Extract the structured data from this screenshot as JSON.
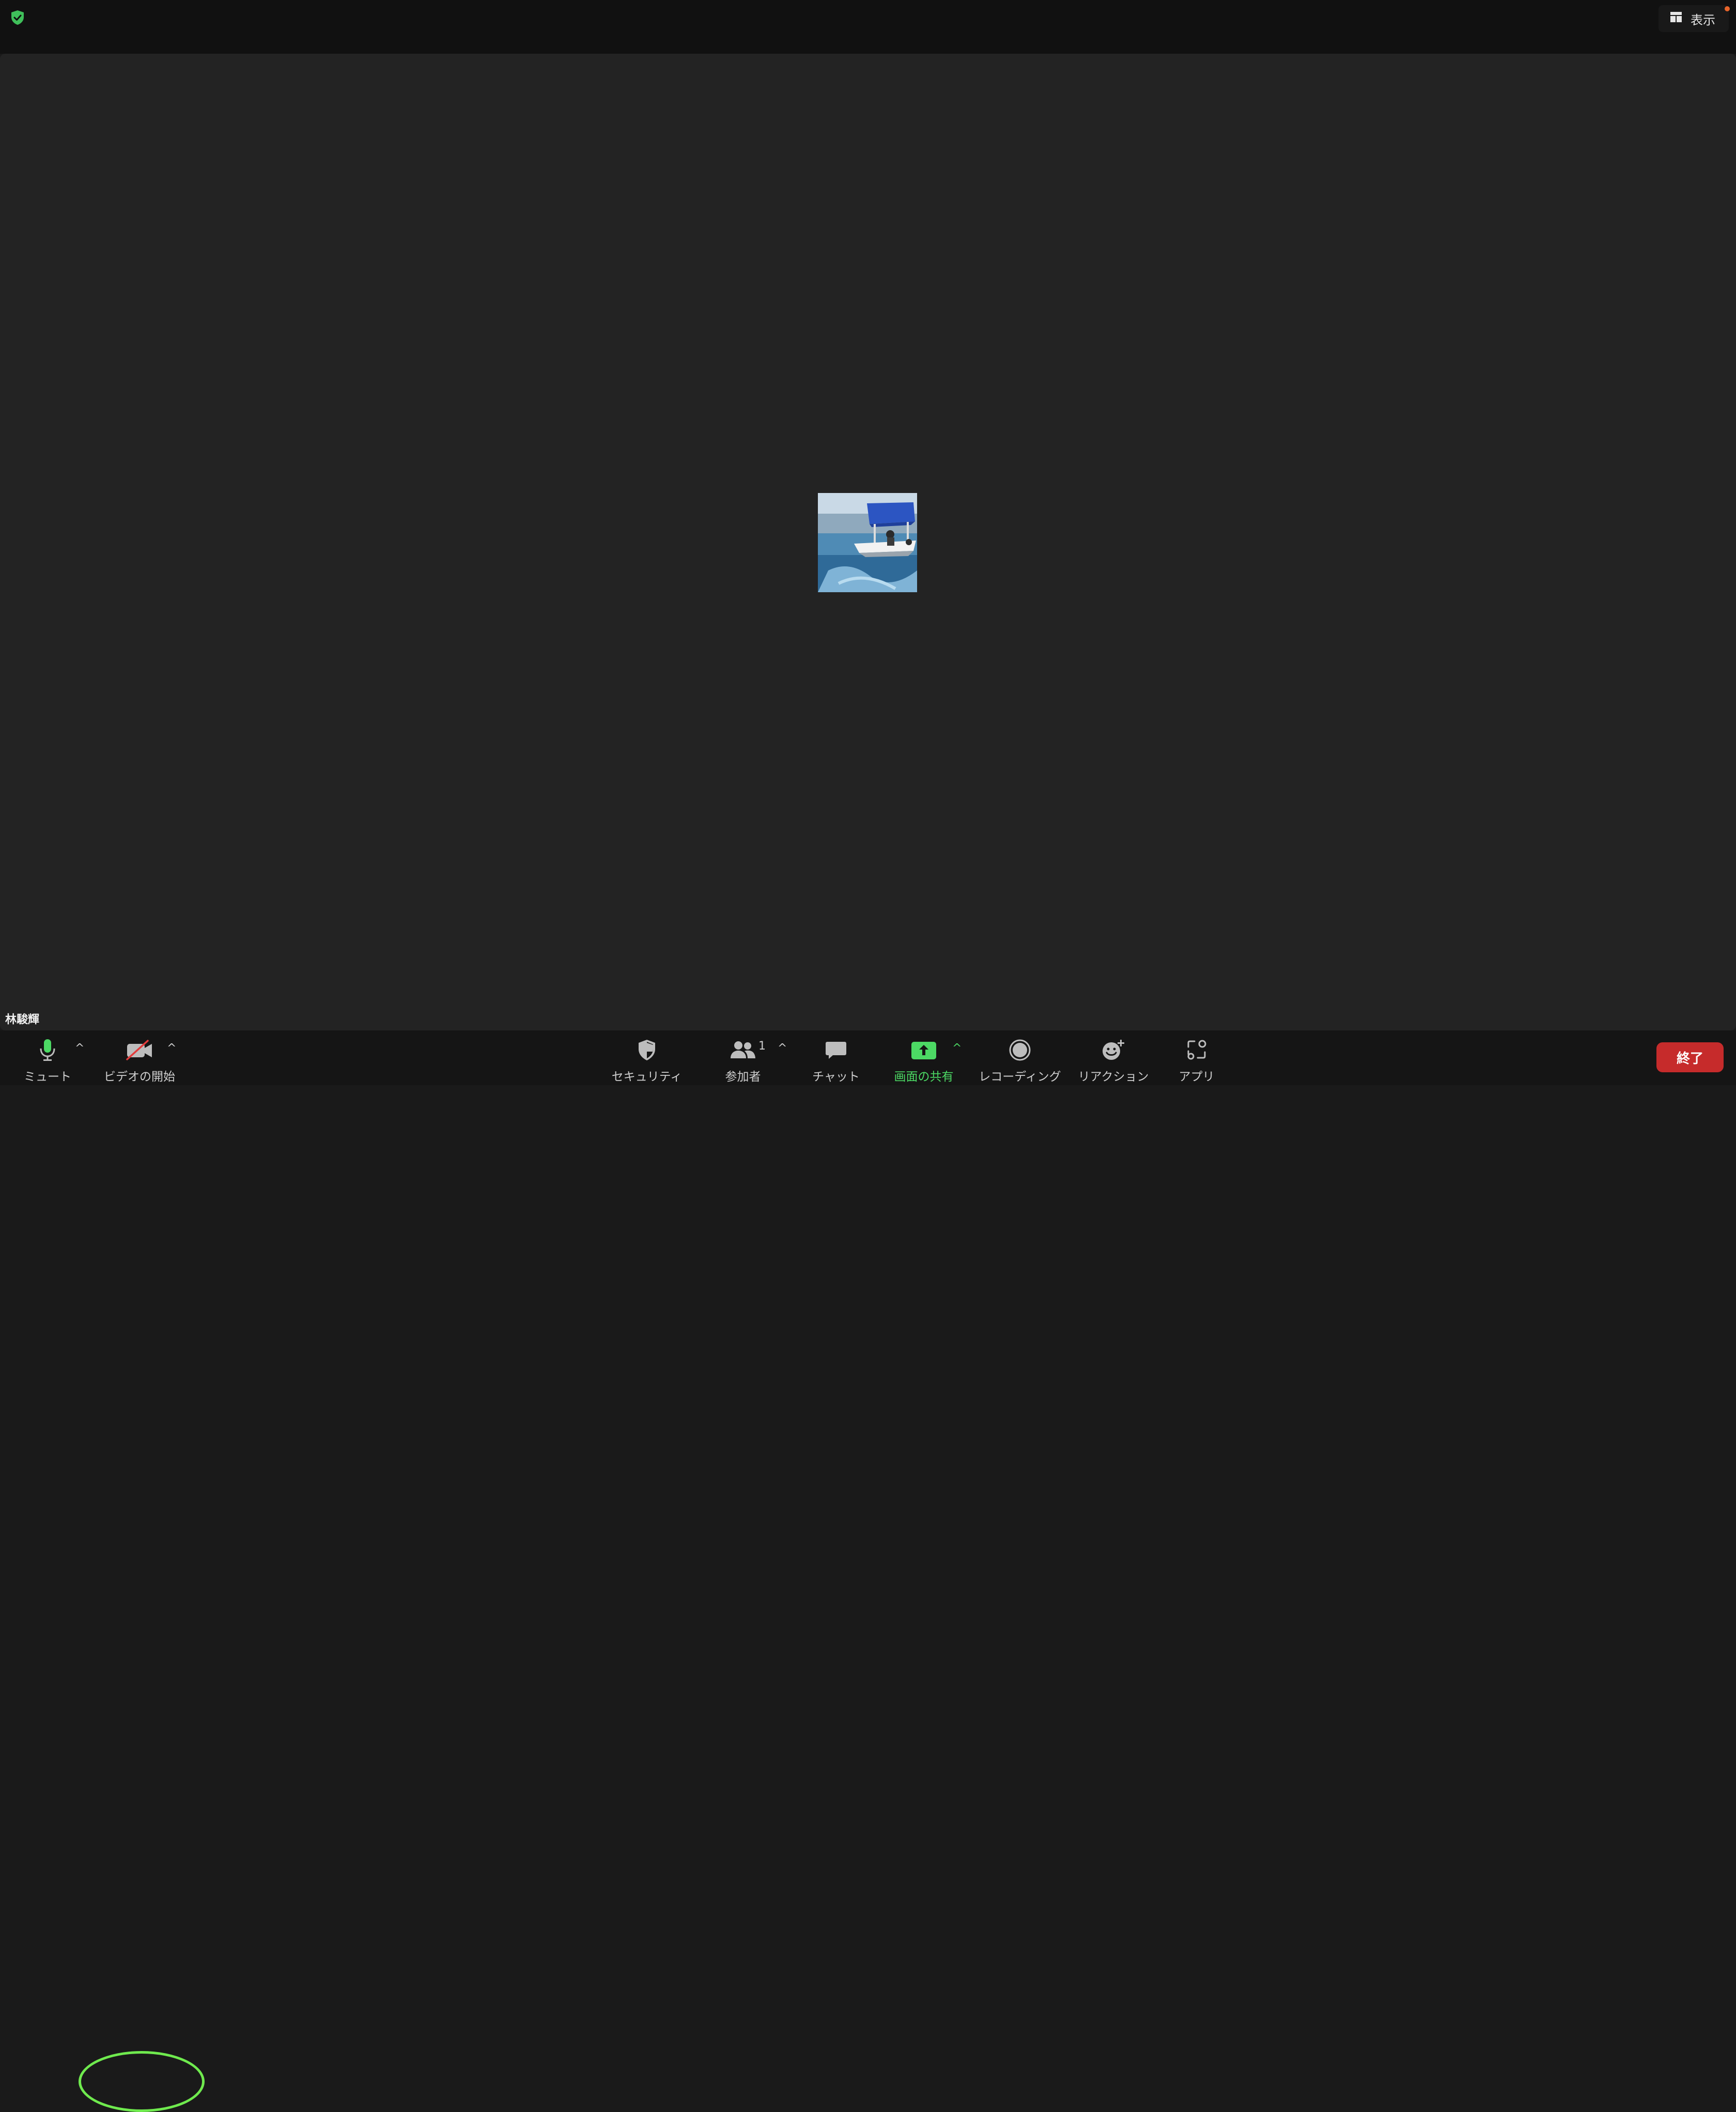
{
  "top_bar": {
    "view_label": "表示"
  },
  "participant": {
    "name": "林駿輝"
  },
  "toolbar": {
    "mute_label": "ミュート",
    "video_label": "ビデオの開始",
    "security_label": "セキュリティ",
    "participants_label": "参加者",
    "participants_count": "1",
    "chat_label": "チャット",
    "share_label": "画面の共有",
    "recording_label": "レコーディング",
    "reactions_label": "リアクション",
    "apps_label": "アプリ",
    "end_label": "終了"
  },
  "icons": {
    "security_shield": "shield-check-icon",
    "view": "grid-icon",
    "mic": "microphone-icon",
    "video": "video-off-icon",
    "security": "shield-icon",
    "participants": "people-icon",
    "chat": "chat-bubble-icon",
    "share": "share-screen-icon",
    "recording": "record-icon",
    "reactions": "emoji-plus-icon",
    "apps": "apps-icon"
  },
  "colors": {
    "accent_green": "#4cd964",
    "end_red": "#c62b2b",
    "annotation_green": "#6fea4e",
    "muted_slash": "#e23b3b"
  }
}
